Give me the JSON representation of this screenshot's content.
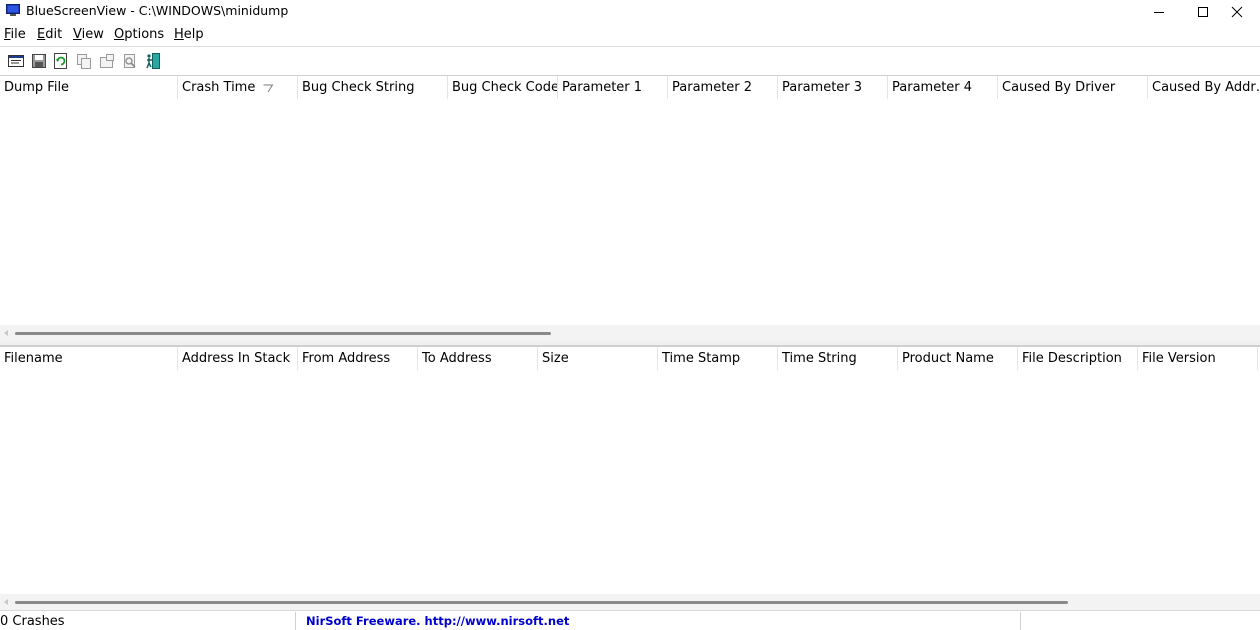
{
  "window": {
    "title": "BlueScreenView  -  C:\\WINDOWS\\minidump",
    "controls": {
      "minimize": "—",
      "maximize": "☐",
      "close": "✕"
    }
  },
  "menu": [
    {
      "accel": "F",
      "rest": "ile"
    },
    {
      "accel": "E",
      "rest": "dit"
    },
    {
      "accel": "V",
      "rest": "iew"
    },
    {
      "accel": "O",
      "rest": "ptions"
    },
    {
      "accel": "H",
      "rest": "elp"
    }
  ],
  "toolbar_icons": [
    "html-report-icon",
    "save-icon",
    "refresh-icon",
    "copy-icon",
    "properties-icon",
    "find-icon",
    "exit-icon"
  ],
  "crash_list": {
    "columns": [
      "Dump File",
      "Crash Time",
      "Bug Check String",
      "Bug Check Code",
      "Parameter 1",
      "Parameter 2",
      "Parameter 3",
      "Parameter 4",
      "Caused By Driver",
      "Caused By Addr…"
    ],
    "sorted_column": "Crash Time",
    "rows": []
  },
  "driver_list": {
    "columns": [
      "Filename",
      "Address In Stack",
      "From Address",
      "To Address",
      "Size",
      "Time Stamp",
      "Time String",
      "Product Name",
      "File Description",
      "File Version"
    ],
    "rows": []
  },
  "status": {
    "count": "0 Crashes",
    "link": "NirSoft Freeware.  http://www.nirsoft.net"
  },
  "colors": {
    "link": "#0000cc",
    "app_icon": "#1f3fbf"
  }
}
